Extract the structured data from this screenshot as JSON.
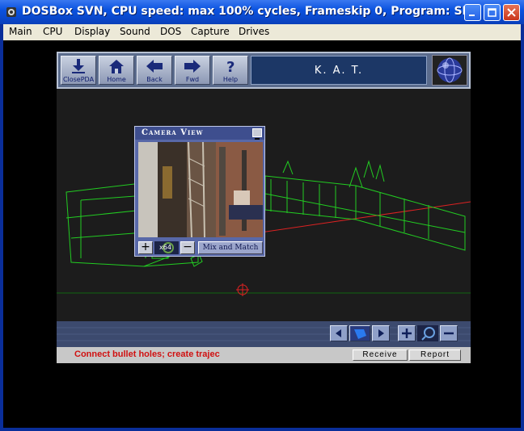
{
  "window": {
    "title": "DOSBox SVN, CPU speed: max 100% cycles, Frameskip  0, Program:   SP...",
    "controls": {
      "minimize": "minimize",
      "maximize": "maximize",
      "close": "close"
    }
  },
  "menubar": {
    "items": [
      "Main",
      "CPU",
      "Display",
      "Sound",
      "DOS",
      "Capture",
      "Drives"
    ]
  },
  "pda": {
    "buttons": [
      {
        "label": "ClosePDA",
        "icon": "close-pda-icon"
      },
      {
        "label": "Home",
        "icon": "home-icon"
      },
      {
        "label": "Back",
        "icon": "back-arrow-icon"
      },
      {
        "label": "Fwd",
        "icon": "forward-arrow-icon"
      },
      {
        "label": "Help",
        "icon": "help-question-icon"
      }
    ],
    "header_text": "K. A. T.",
    "globe_icon": "globe-icon"
  },
  "camera_view": {
    "title": "Camera View",
    "zoom_text": "x64",
    "zoom_in": "+",
    "zoom_out": "−",
    "mix_button": "Mix and Match"
  },
  "nav": {
    "icons": [
      "prev-arrow-icon",
      "bullet-select-icon",
      "next-arrow-icon",
      "zoom-in-icon",
      "magnifier-icon",
      "zoom-out-icon"
    ]
  },
  "status": {
    "message": "Connect bullet holes; create trajec",
    "receive_label": "Receive",
    "report_label": "Report"
  },
  "colors": {
    "title_bar": "#0b53e0",
    "wireframe": "#22cc22",
    "trajectory": "#dd2222",
    "status_text": "#d01010"
  }
}
